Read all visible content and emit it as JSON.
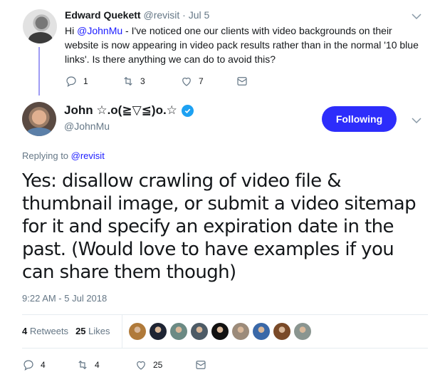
{
  "parent_tweet": {
    "author_name": "Edward Quekett",
    "author_handle": "@revisit",
    "separator": "·",
    "date": "Jul 5",
    "text_prefix": "Hi ",
    "mention": "@JohnMu",
    "text_rest": " - I've noticed one our clients with video backgrounds on their website is now appearing in video pack results rather than in the normal '10 blue links'. Is there anything we can do to avoid this?",
    "actions": {
      "reply_icon": "reply-icon",
      "reply_count": "1",
      "retweet_icon": "retweet-icon",
      "retweet_count": "3",
      "like_icon": "heart-icon",
      "like_count": "7",
      "dm_icon": "envelope-icon"
    }
  },
  "main_tweet": {
    "author_name": "John ☆.o(≧▽≦)o.☆",
    "verified": true,
    "author_handle": "@JohnMu",
    "follow_button_label": "Following",
    "replying_prefix": "Replying to ",
    "replying_to": "@revisit",
    "text": "Yes: disallow crawling of video file & thumbnail image, or submit a video sitemap for it and specify an expiration date in the past. (Would love to have examples if you can share them though)",
    "timestamp": "9:22 AM - 5 Jul 2018",
    "stats": {
      "retweets_count": "4",
      "retweets_label": "Retweets",
      "likes_count": "25",
      "likes_label": "Likes"
    },
    "liker_avatars": [
      {
        "color": "#b07a3a"
      },
      {
        "color": "#1e2433"
      },
      {
        "color": "#6b8a84"
      },
      {
        "color": "#4d5b66"
      },
      {
        "color": "#111111"
      },
      {
        "color": "#9c8b7a"
      },
      {
        "color": "#3a68a8"
      },
      {
        "color": "#7a4a28"
      },
      {
        "color": "#8a9590"
      }
    ],
    "actions": {
      "reply_icon": "reply-icon",
      "reply_count": "4",
      "retweet_icon": "retweet-icon",
      "retweet_count": "4",
      "like_icon": "heart-icon",
      "like_count": "25",
      "dm_icon": "envelope-icon"
    }
  },
  "colors": {
    "accent": "#2d2dfb",
    "mention": "#1b1bff",
    "thread_line": "#9f9cf4",
    "verified": "#1da1f2",
    "secondary_text": "#657786"
  }
}
